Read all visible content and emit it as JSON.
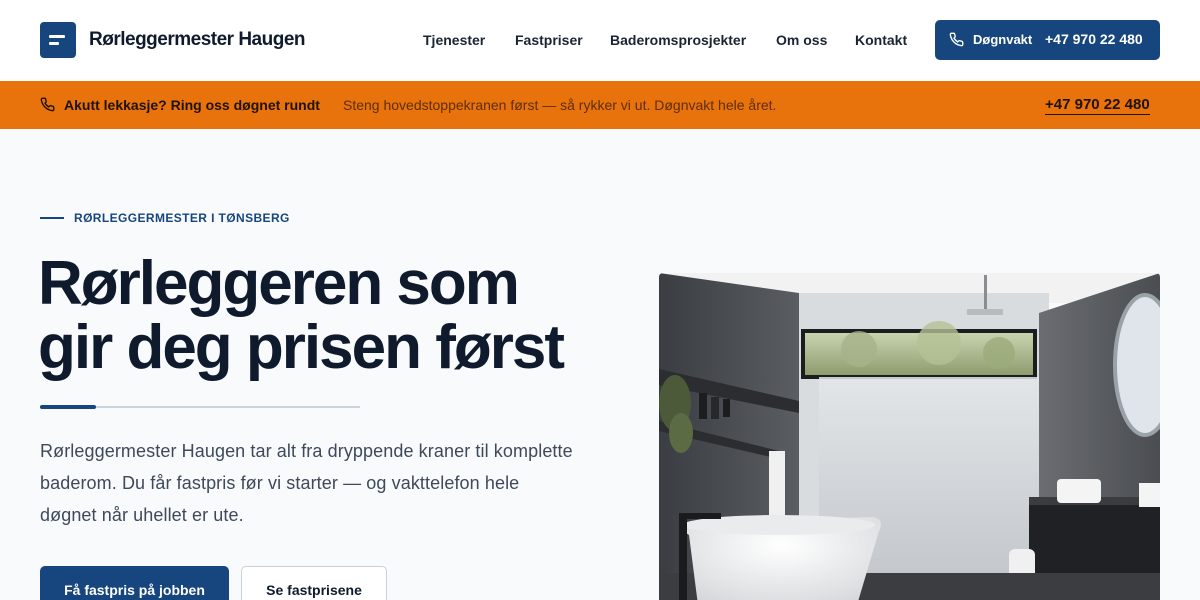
{
  "header": {
    "brand": "Rørleggermester Haugen",
    "nav": [
      "Tjenester",
      "Fastpriser",
      "Baderomsprosjekter",
      "Om oss",
      "Kontakt"
    ],
    "cta_label": "Døgnvakt",
    "cta_phone": "+47 970 22 480"
  },
  "alert": {
    "title": "Akutt lekkasje? Ring oss døgnet rundt",
    "message": "Steng hovedstoppekranen først — så rykker vi ut. Døgnvakt hele året.",
    "phone": "+47 970 22 480"
  },
  "hero": {
    "eyebrow": "RØRLEGGERMESTER I TØNSBERG",
    "headline_line1": "Rørleggeren som",
    "headline_line2": "gir deg prisen først",
    "lead_line1": "Rørleggermester Haugen tar alt fra dryppende kraner til komplette",
    "lead_line2": "baderom. Du får fastpris før vi starter — og vakttelefon hele",
    "lead_line3": "døgnet når uhellet er ute.",
    "primary_button": "Få fastpris på jobben",
    "secondary_button": "Se fastprisene"
  },
  "colors": {
    "brand_navy": "#17457e",
    "alert_orange": "#e8720c",
    "text_dark": "#0f1b2d"
  },
  "icons": [
    "logo-mark",
    "phone-icon"
  ]
}
